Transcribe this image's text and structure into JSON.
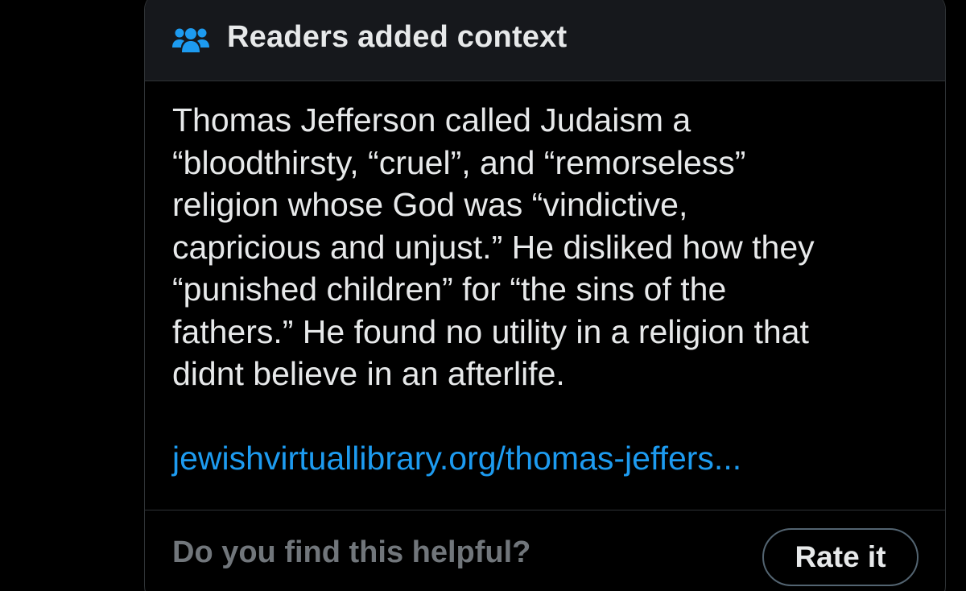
{
  "note": {
    "header_title": "Readers added context",
    "header_icon": "people-group-icon",
    "body_text": "Thomas Jefferson called Judaism a\n“bloodthirsty, “cruel”, and “remorseless”\nreligion whose God was “vindictive,\ncapricious and unjust.” He disliked how they\n“punished children” for “the sins of the\nfathers.” He found no utility in a religion that\ndidnt believe in an afterlife.",
    "source_link": "jewishvirtuallibrary.org/thomas-jeffers..."
  },
  "footer": {
    "prompt": "Do you find this helpful?",
    "rate_label": "Rate it"
  },
  "colors": {
    "background": "#000000",
    "header_bg": "#16181c",
    "border": "#2f3336",
    "text_primary": "#e7e9ea",
    "text_secondary": "#71767b",
    "link": "#1d9bf0"
  }
}
